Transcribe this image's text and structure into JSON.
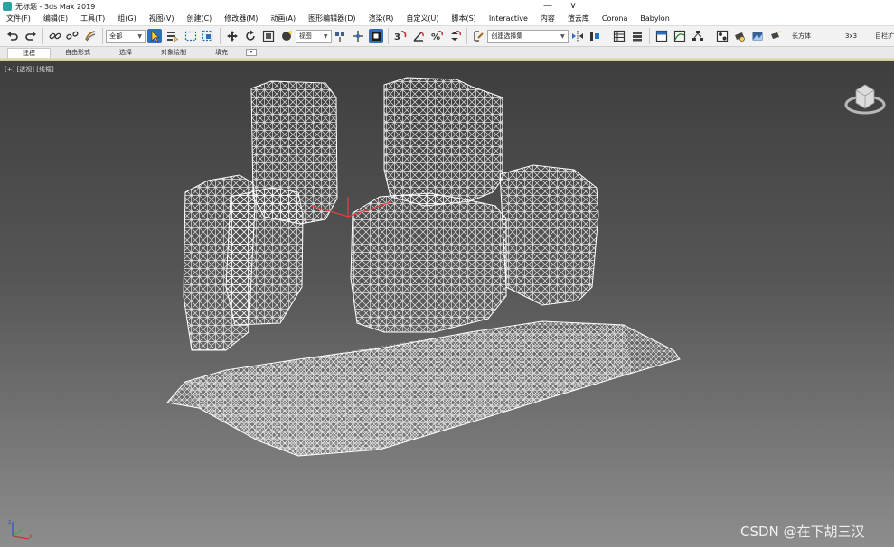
{
  "window": {
    "title": "无标题 - 3ds Max 2019",
    "minimize_glyph": "—",
    "restore_glyph": "∨"
  },
  "menu": {
    "items": [
      "文件(F)",
      "编辑(E)",
      "工具(T)",
      "组(G)",
      "视图(V)",
      "创建(C)",
      "修改器(M)",
      "动画(A)",
      "图形编辑器(D)",
      "渲染(R)",
      "自定义(U)",
      "脚本(S)",
      "Interactive",
      "内容",
      "渲云库",
      "Corona",
      "Babylon"
    ]
  },
  "toolbar": {
    "selection_filter": "全部",
    "reference_coord": "视图",
    "named_selection": "创建选择集",
    "right_text_1": "长方体",
    "right_text_2": "3x3",
    "right_text_3": "目栏扩"
  },
  "ribbon": {
    "tabs": [
      "建模",
      "自由形式",
      "选择",
      "对象绘制",
      "填充"
    ],
    "active_index": 0,
    "toggle_glyph": "▾"
  },
  "viewport": {
    "label": "[+] [透视] [线框]",
    "watermark": "CSDN @在下胡三汉"
  },
  "colors": {
    "selected_tool": "#2d6fb8",
    "viewport_top": "#3e3e3e",
    "viewport_bottom": "#8d8d8d",
    "wireframe": "#ffffff",
    "axis_x": "#d03030",
    "axis_y": "#30b030",
    "axis_z": "#3050d0"
  },
  "icons": [
    "undo-icon",
    "redo-icon",
    "link-icon",
    "unlink-icon",
    "bind-space-warp-icon",
    "select-object-icon",
    "select-by-name-icon",
    "rect-region-icon",
    "window-crossing-icon",
    "move-icon",
    "rotate-icon",
    "scale-icon",
    "place-icon",
    "pivot-icon",
    "manipulate-icon",
    "keyboard-shortcut-icon",
    "snap-3d-icon",
    "angle-snap-icon",
    "percent-snap-icon",
    "spinner-snap-icon",
    "edit-named-selection-icon",
    "mirror-icon",
    "align-icon",
    "scene-explorer-icon",
    "layer-explorer-icon",
    "ribbon-toggle-icon",
    "curve-editor-icon",
    "schematic-view-icon",
    "material-editor-icon",
    "render-setup-icon",
    "rendered-frame-icon",
    "render-icon",
    "viewcube-icon",
    "axis-tripod-icon"
  ]
}
